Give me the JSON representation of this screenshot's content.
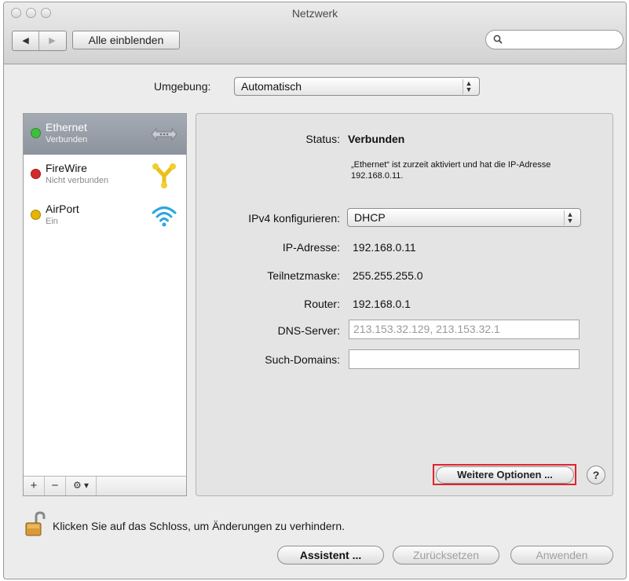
{
  "window": {
    "title": "Netzwerk"
  },
  "toolbar": {
    "back_glyph": "◀",
    "forward_glyph": "▶",
    "show_all_label": "Alle einblenden",
    "search_placeholder": "",
    "search_icon": "search-icon"
  },
  "location": {
    "label": "Umgebung:",
    "value": "Automatisch"
  },
  "services": [
    {
      "name": "Ethernet",
      "status": "Verbunden",
      "status_color": "#3fbf3f",
      "icon": "ethernet-icon",
      "selected": true
    },
    {
      "name": "FireWire",
      "status": "Nicht verbunden",
      "status_color": "#d52a2a",
      "icon": "firewire-icon",
      "selected": false
    },
    {
      "name": "AirPort",
      "status": "Ein",
      "status_color": "#e6b400",
      "icon": "wifi-icon",
      "selected": false
    }
  ],
  "sidebar_controls": {
    "add": "+",
    "remove": "−",
    "action": "⚙ ▾"
  },
  "details": {
    "status_label": "Status:",
    "status_value": "Verbunden",
    "status_desc": "„Ethernet“ ist zurzeit aktiviert und hat die IP-Adresse 192.168.0.11.",
    "ipv4_label": "IPv4 konfigurieren:",
    "ipv4_value": "DHCP",
    "ip_label": "IP-Adresse:",
    "ip_value": "192.168.0.11",
    "subnet_label": "Teilnetzmaske:",
    "subnet_value": "255.255.255.0",
    "router_label": "Router:",
    "router_value": "192.168.0.1",
    "dns_label": "DNS-Server:",
    "dns_value": "213.153.32.129, 213.153.32.1",
    "search_domains_label": "Such-Domains:",
    "search_domains_value": ""
  },
  "advanced_button": "Weitere Optionen ...",
  "help_glyph": "?",
  "lock_text": "Klicken Sie auf das Schloss, um Änderungen zu verhindern.",
  "buttons": {
    "assistant": "Assistent ...",
    "revert": "Zurücksetzen",
    "apply": "Anwenden"
  },
  "colors": {
    "selection": "#9aa0a9",
    "highlight_border": "#e0242c"
  }
}
